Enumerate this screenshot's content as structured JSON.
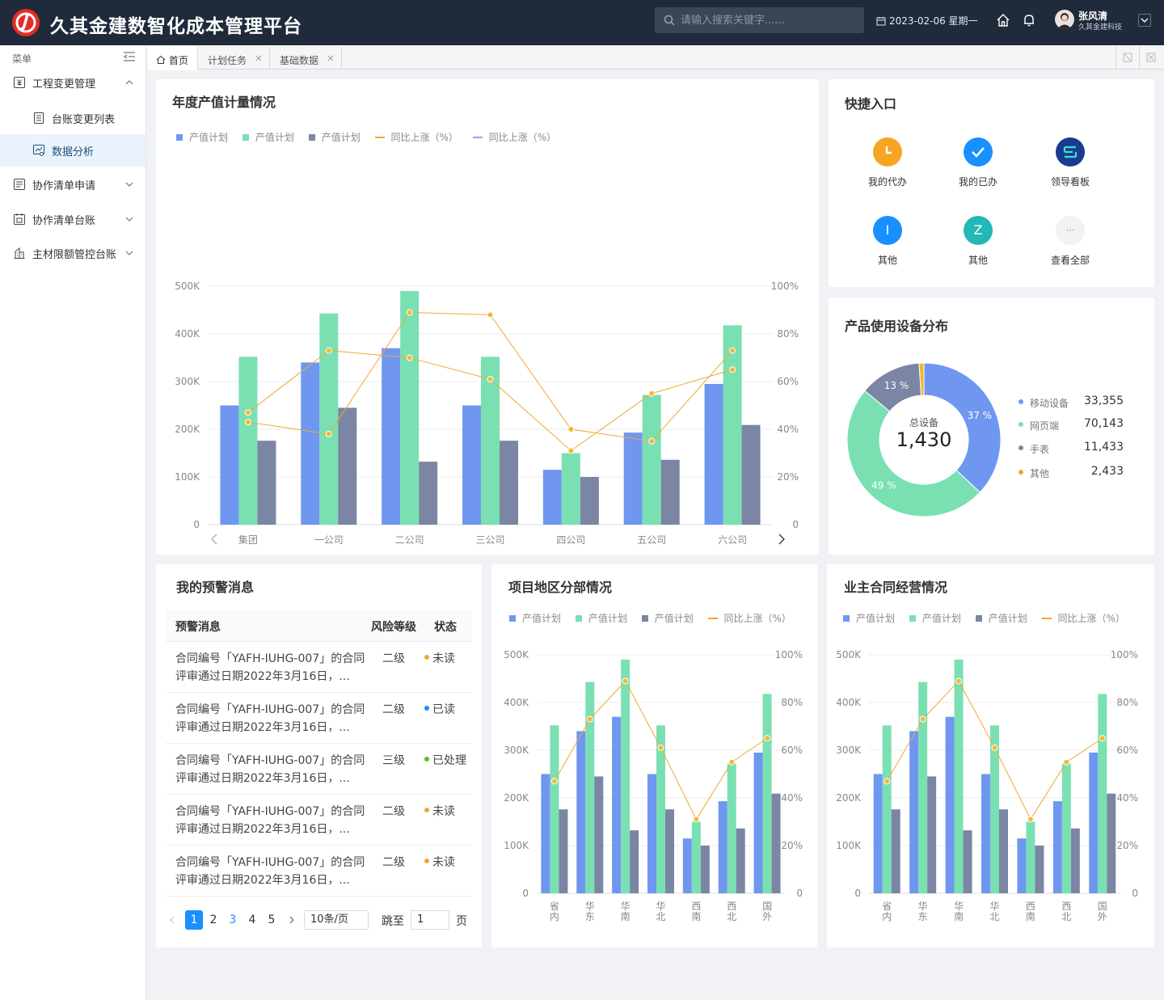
{
  "app": {
    "title": "久其金建数智化成本管理平台"
  },
  "search": {
    "placeholder": "请输入搜索关键字......"
  },
  "header": {
    "date": "2023-02-06 星期一"
  },
  "user": {
    "name": "张风清",
    "company": "久其金建科技"
  },
  "sidebar": {
    "menu_label": "菜单",
    "items": [
      {
        "label": "工程变更管理"
      },
      {
        "label": "台账变更列表"
      },
      {
        "label": "数据分析"
      },
      {
        "label": "协作清单申请"
      },
      {
        "label": "协作清单台账"
      },
      {
        "label": "主材限额管控台账"
      }
    ]
  },
  "tabs": [
    {
      "label": "首页"
    },
    {
      "label": "计划任务"
    },
    {
      "label": "基础数据"
    }
  ],
  "colors": {
    "blue": "#6f97f0",
    "green": "#7ae0b2",
    "slate": "#7a86a3",
    "orange": "#f0a733",
    "header": "#1f2a3b",
    "primary": "#1890ff"
  },
  "annual": {
    "title": "年度产值计量情况",
    "legend": [
      "产值计划",
      "产值计划",
      "产值计划",
      "同比上涨（%）",
      "同比上涨（%）"
    ]
  },
  "quick": {
    "title": "快捷入口",
    "items": [
      {
        "label": "我的代办",
        "icon": "clock-icon",
        "color": "#f6a623"
      },
      {
        "label": "我的已办",
        "icon": "check-icon",
        "color": "#1890ff"
      },
      {
        "label": "领导看板",
        "icon": "dashboard-icon",
        "color": "#1a3c8f"
      },
      {
        "label": "其他",
        "glyph": "I",
        "color": "#1890ff"
      },
      {
        "label": "其他",
        "glyph": "Z",
        "color": "#23b7b7"
      },
      {
        "label": "查看全部",
        "glyph": "···",
        "color": "#f2f2f2"
      }
    ]
  },
  "devices": {
    "title": "产品使用设备分布",
    "center_label": "总设备",
    "center_value": "1,430",
    "items": [
      {
        "name": "移动设备",
        "value": "33,355"
      },
      {
        "name": "网页端",
        "value": "70,143"
      },
      {
        "name": "手表",
        "value": "11,433"
      },
      {
        "name": "其他",
        "value": "2,433"
      }
    ]
  },
  "warnings": {
    "title": "我的预警消息",
    "headers": [
      "预警消息",
      "风险等级",
      "状态"
    ],
    "rows": [
      {
        "msg": "合同编号「YAFH-IUHG-007」的合同评审通过日期2022年3月16日，...",
        "level": "二级",
        "status": "未读",
        "status_color": "#f0a733"
      },
      {
        "msg": "合同编号「YAFH-IUHG-007」的合同评审通过日期2022年3月16日，...",
        "level": "二级",
        "status": "已读",
        "status_color": "#1890ff"
      },
      {
        "msg": "合同编号「YAFH-IUHG-007」的合同评审通过日期2022年3月16日，...",
        "level": "三级",
        "status": "已处理",
        "status_color": "#52c41a"
      },
      {
        "msg": "合同编号「YAFH-IUHG-007」的合同评审通过日期2022年3月16日，...",
        "level": "二级",
        "status": "未读",
        "status_color": "#f0a733"
      },
      {
        "msg": "合同编号「YAFH-IUHG-007」的合同评审通过日期2022年3月16日，...",
        "level": "二级",
        "status": "未读",
        "status_color": "#f0a733"
      }
    ],
    "pager": {
      "pages": [
        "1",
        "2",
        "3",
        "4",
        "5"
      ],
      "current": "1",
      "page_size": "10条/页",
      "jump_label": "跳至",
      "jump_value": "1",
      "page_unit": "页"
    }
  },
  "region": {
    "title": "项目地区分部情况",
    "legend": [
      "产值计划",
      "产值计划",
      "产值计划",
      "同比上涨（%）"
    ]
  },
  "owner": {
    "title": "业主合同经营情况",
    "legend": [
      "产值计划",
      "产值计划",
      "产值计划",
      "同比上涨（%）"
    ]
  },
  "chart_data": [
    {
      "type": "bar",
      "title": "年度产值计量情况",
      "categories": [
        "集团",
        "一公司",
        "二公司",
        "三公司",
        "四公司",
        "五公司",
        "六公司"
      ],
      "y_ticks": [
        "0",
        "100K",
        "200K",
        "300K",
        "400K",
        "500K"
      ],
      "y2_ticks": [
        "0",
        "20%",
        "40%",
        "60%",
        "80%",
        "100%"
      ],
      "ylim": [
        0,
        500000
      ],
      "y2lim": [
        0,
        100
      ],
      "series": [
        {
          "name": "产值计划",
          "kind": "bar",
          "values": [
            250000,
            340000,
            370000,
            250000,
            115000,
            193000,
            295000
          ]
        },
        {
          "name": "产值计划",
          "kind": "bar",
          "values": [
            352000,
            443000,
            490000,
            352000,
            150000,
            272000,
            418000
          ]
        },
        {
          "name": "产值计划",
          "kind": "bar",
          "values": [
            176000,
            245000,
            132000,
            176000,
            100000,
            136000,
            209000
          ]
        },
        {
          "name": "同比上涨（%）",
          "kind": "line",
          "values": [
            47,
            73,
            70,
            61,
            31,
            55,
            65
          ]
        },
        {
          "name": "同比上涨（%）",
          "kind": "line",
          "values": [
            43,
            38,
            89,
            88,
            40,
            35,
            73
          ]
        }
      ]
    },
    {
      "type": "pie",
      "title": "产品使用设备分布",
      "categories": [
        "移动设备",
        "网页端",
        "手表",
        "其他"
      ],
      "values": [
        37,
        49,
        13,
        1
      ],
      "labels": [
        "37 %",
        "49 %",
        "13 %",
        ""
      ]
    },
    {
      "type": "bar",
      "title": "项目地区分部情况",
      "categories": [
        "省内",
        "华东",
        "华南",
        "华北",
        "西南",
        "西北",
        "国外"
      ],
      "y_ticks": [
        "0",
        "100K",
        "200K",
        "300K",
        "400K",
        "500K"
      ],
      "y2_ticks": [
        "0",
        "20%",
        "40%",
        "60%",
        "80%",
        "100%"
      ],
      "ylim": [
        0,
        500000
      ],
      "y2lim": [
        0,
        100
      ],
      "series": [
        {
          "name": "产值计划",
          "kind": "bar",
          "values": [
            250000,
            340000,
            370000,
            250000,
            115000,
            193000,
            295000
          ]
        },
        {
          "name": "产值计划",
          "kind": "bar",
          "values": [
            352000,
            443000,
            490000,
            352000,
            150000,
            272000,
            418000
          ]
        },
        {
          "name": "产值计划",
          "kind": "bar",
          "values": [
            176000,
            245000,
            132000,
            176000,
            100000,
            136000,
            209000
          ]
        },
        {
          "name": "同比上涨（%）",
          "kind": "line",
          "values": [
            47,
            73,
            89,
            61,
            31,
            55,
            65
          ]
        }
      ]
    },
    {
      "type": "bar",
      "title": "业主合同经营情况",
      "categories": [
        "省内",
        "华东",
        "华南",
        "华北",
        "西南",
        "西北",
        "国外"
      ],
      "y_ticks": [
        "0",
        "100K",
        "200K",
        "300K",
        "400K",
        "500K"
      ],
      "y2_ticks": [
        "0",
        "20%",
        "40%",
        "60%",
        "80%",
        "100%"
      ],
      "ylim": [
        0,
        500000
      ],
      "y2lim": [
        0,
        100
      ],
      "series": [
        {
          "name": "产值计划",
          "kind": "bar",
          "values": [
            250000,
            340000,
            370000,
            250000,
            115000,
            193000,
            295000
          ]
        },
        {
          "name": "产值计划",
          "kind": "bar",
          "values": [
            352000,
            443000,
            490000,
            352000,
            150000,
            272000,
            418000
          ]
        },
        {
          "name": "产值计划",
          "kind": "bar",
          "values": [
            176000,
            245000,
            132000,
            176000,
            100000,
            136000,
            209000
          ]
        },
        {
          "name": "同比上涨（%）",
          "kind": "line",
          "values": [
            47,
            73,
            89,
            61,
            31,
            55,
            65
          ]
        }
      ]
    }
  ]
}
